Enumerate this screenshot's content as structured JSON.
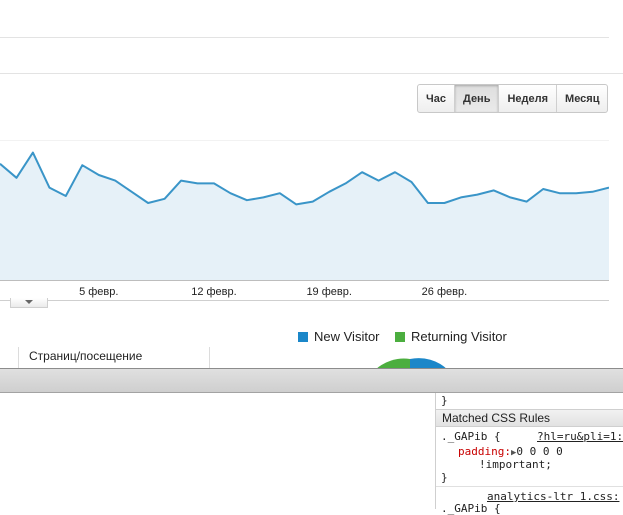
{
  "granularity": {
    "options": [
      "Час",
      "День",
      "Неделя",
      "Месяц"
    ],
    "selected_index": 1
  },
  "chart_data": {
    "type": "area",
    "x_tick_labels": [
      "5 февр.",
      "12 февр.",
      "19 февр.",
      "26 февр."
    ],
    "x_tick_indices": [
      6,
      13,
      20,
      27
    ],
    "values": [
      83,
      73,
      91,
      66,
      60,
      82,
      75,
      71,
      63,
      55,
      58,
      71,
      69,
      69,
      62,
      57,
      59,
      62,
      54,
      56,
      63,
      69,
      77,
      71,
      77,
      70,
      55,
      55,
      59,
      61,
      64,
      59,
      56,
      65,
      62,
      62,
      63,
      66
    ],
    "ylim": [
      0,
      100
    ],
    "grid": true,
    "color": "#3a95c8",
    "fill": "#e6f1f8"
  },
  "legend": {
    "items": [
      {
        "label": "New Visitor",
        "color": "#1b87c9"
      },
      {
        "label": "Returning Visitor",
        "color": "#4cae3f"
      }
    ]
  },
  "table": {
    "column_header": "Страниц/посещение"
  },
  "devtools": {
    "closing_brace": "}",
    "section_title": "Matched CSS Rules",
    "rule1": {
      "selector": "._GAPib {",
      "source": "?hl=ru&pli=1:",
      "property_name": "padding:",
      "toggle": "▶",
      "property_value": "0 0 0 0",
      "important": "!important;",
      "close": "}"
    },
    "rule2": {
      "source": "analytics-ltr 1.css:",
      "selector": "._GAPib {"
    }
  }
}
